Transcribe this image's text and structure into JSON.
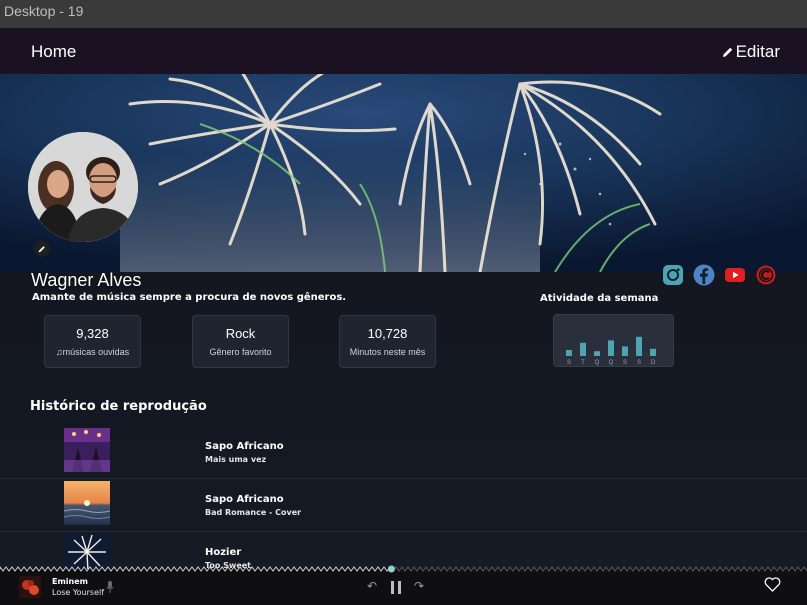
{
  "window": {
    "title": "Desktop - 19"
  },
  "header": {
    "home_label": "Home",
    "edit_label": "Editar"
  },
  "profile": {
    "name": "Wagner Alves",
    "bio": "Amante de música sempre a procura de novos gêneros.",
    "socials": [
      "instagram-icon",
      "facebook-icon",
      "youtube-icon",
      "custom-c-icon"
    ]
  },
  "stats": [
    {
      "value": "9,328",
      "label": "músicas ouvidas"
    },
    {
      "value": "Rock",
      "label": "Gênero favorito"
    },
    {
      "value": "10,728",
      "label": "Minutos neste mês"
    }
  ],
  "activity": {
    "title": "Atividade da semana",
    "days": [
      "S",
      "T",
      "Q",
      "Q",
      "S",
      "S",
      "D"
    ],
    "levels": [
      0.25,
      0.55,
      0.2,
      0.65,
      0.4,
      0.8,
      0.3
    ],
    "color": "#4fa3b3"
  },
  "history": {
    "title": "Histórico de reprodução",
    "items": [
      {
        "title": "Sapo Africano",
        "subtitle": "Mais uma vez"
      },
      {
        "title": "Sapo Africano",
        "subtitle": "Bad Romance - Cover"
      },
      {
        "title": "Hozier",
        "subtitle": "Too Sweet"
      }
    ]
  },
  "player": {
    "artist": "Eminem",
    "song": "Lose Yourself",
    "progress": 0.485,
    "accent": "#8fd0d0"
  }
}
